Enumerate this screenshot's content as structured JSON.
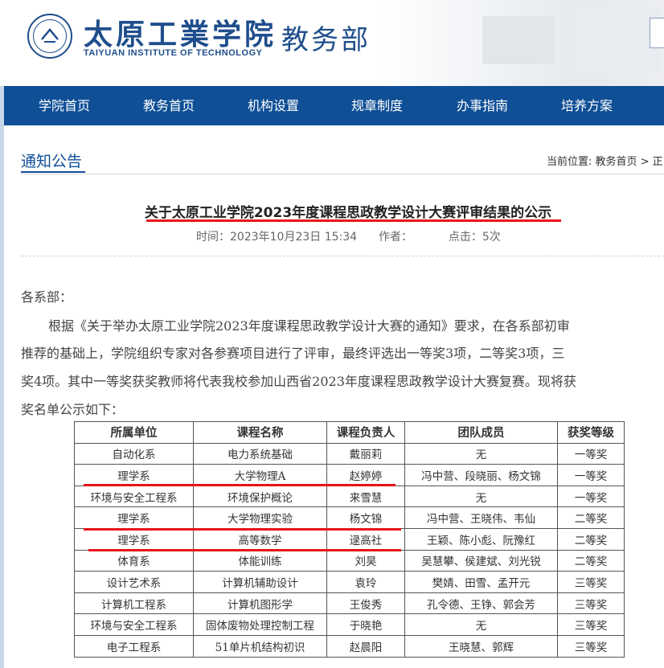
{
  "header": {
    "school_cn": "太原工業学院",
    "school_en": "TAIYUAN INSTITUTE OF TECHNOLOGY",
    "dept": "教务部"
  },
  "nav": [
    "学院首页",
    "教务首页",
    "机构设置",
    "规章制度",
    "办事指南",
    "培养方案"
  ],
  "section": {
    "title": "通知公告",
    "breadcrumb": "当前位置: 教务首页 > 正"
  },
  "article": {
    "title": "关于太原工业学院2023年度课程思政教学设计大赛评审结果的公示",
    "time": "时间：2023年10月23日 15:34",
    "author": "作者：",
    "clicks": "点击：5次",
    "salutation": "各系部：",
    "p1": "根据《关于举办太原工业学院2023年度课程思政教学设计大赛的通知》要求，在各系部初审",
    "p2": "推荐的基础上，学院组织专家对各参赛项目进行了评审，最终评选出一等奖3项，二等奖3项，三",
    "p3": "奖4项。其中一等奖获奖教师将代表我校参加山西省2023年度课程思政教学设计大赛复赛。现将获",
    "p4": "奖名单公示如下："
  },
  "table": {
    "headers": [
      "所属单位",
      "课程名称",
      "课程负责人",
      "团队成员",
      "获奖等级"
    ],
    "rows": [
      [
        "自动化系",
        "电力系统基础",
        "戴丽莉",
        "无",
        "一等奖"
      ],
      [
        "理学系",
        "大学物理A",
        "赵婷婷",
        "冯中营、段晓丽、杨文锦",
        "一等奖"
      ],
      [
        "环境与安全工程系",
        "环境保护概论",
        "来雪慧",
        "无",
        "一等奖"
      ],
      [
        "理学系",
        "大学物理实验",
        "杨文锦",
        "冯中营、王晓伟、韦仙",
        "二等奖"
      ],
      [
        "理学系",
        "高等数学",
        "逯高社",
        "王颖、陈小彪、阮豫红",
        "二等奖"
      ],
      [
        "体育系",
        "体能训练",
        "刘昊",
        "吴慧攀、侯建斌、刘光锐",
        "二等奖"
      ],
      [
        "设计艺术系",
        "计算机辅助设计",
        "袁玲",
        "樊婧、田雪、孟开元",
        "三等奖"
      ],
      [
        "计算机工程系",
        "计算机图形学",
        "王俊秀",
        "孔令德、王铮、郭会芳",
        "三等奖"
      ],
      [
        "环境与安全工程系",
        "固体废物处理控制工程",
        "于晓艳",
        "无",
        "三等奖"
      ],
      [
        "电子工程系",
        "51单片机结构初识",
        "赵晨阳",
        "王晓慧、郭辉",
        "三等奖"
      ]
    ]
  },
  "colors": {
    "brand": "#0f4f96",
    "annotation": "#e8121b"
  },
  "icons": [
    "school-logo-icon"
  ]
}
